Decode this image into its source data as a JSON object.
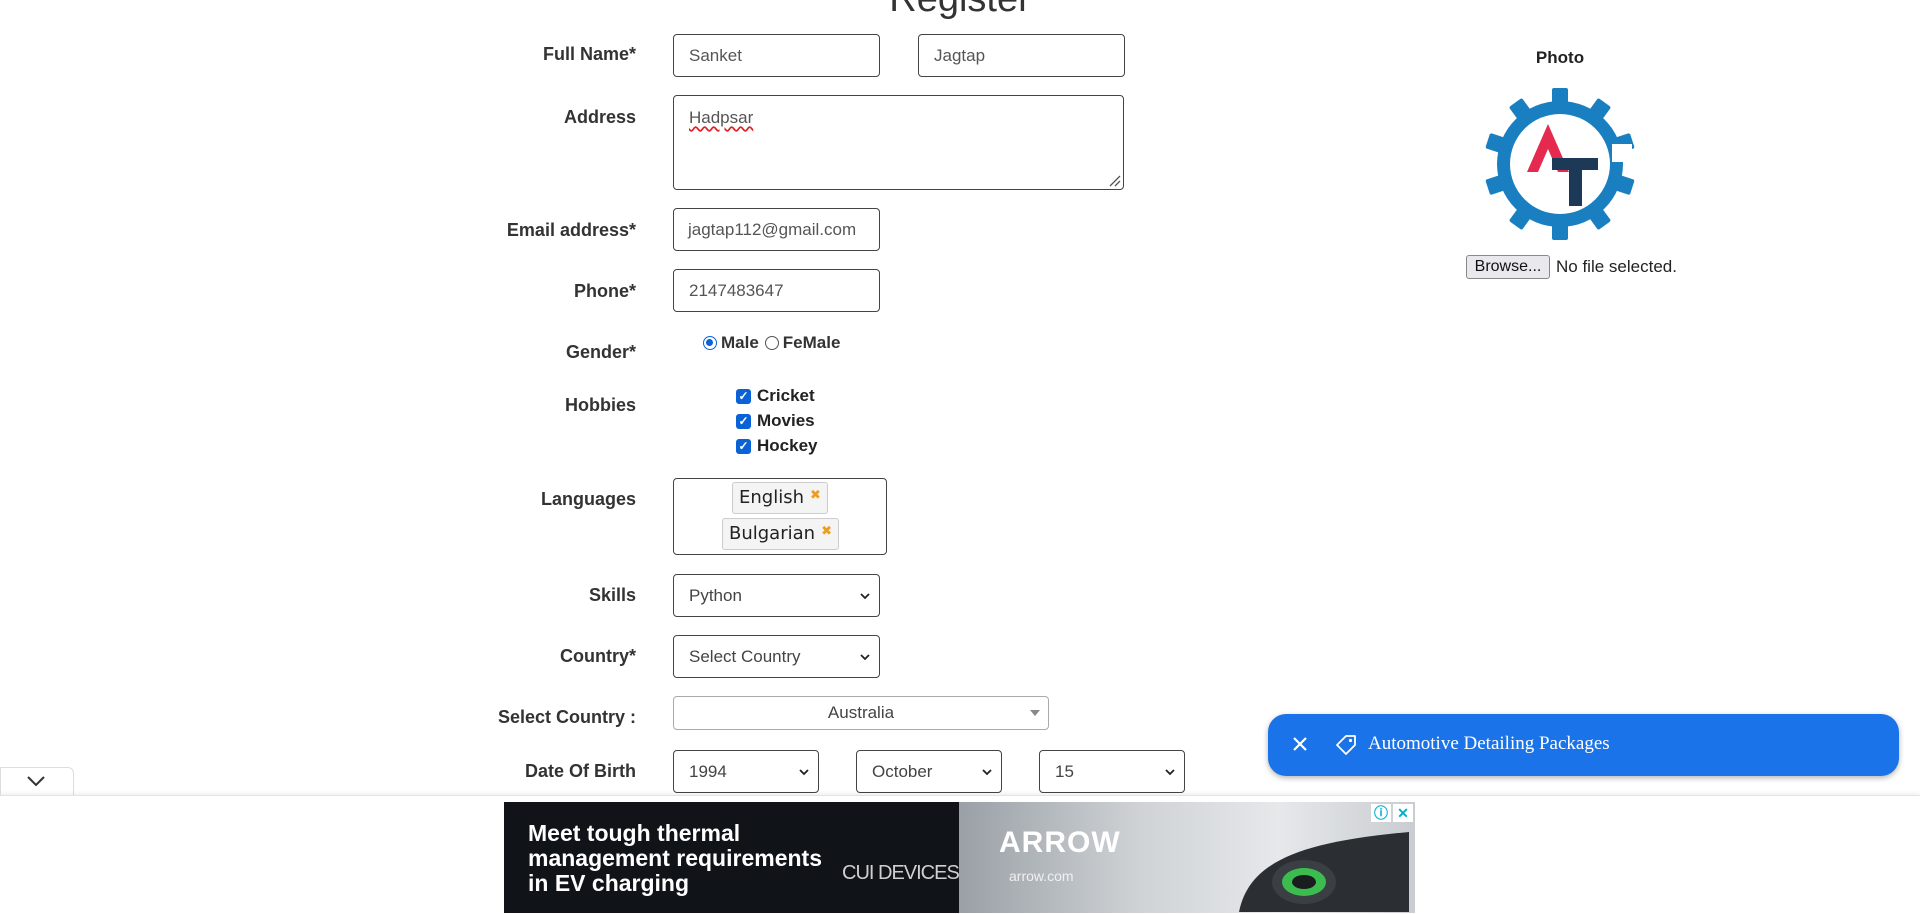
{
  "page": {
    "title": "Register"
  },
  "form": {
    "full_name": {
      "label": "Full Name*",
      "first": "Sanket",
      "last": "Jagtap"
    },
    "address": {
      "label": "Address",
      "value": "Hadpsar"
    },
    "email": {
      "label": "Email address*",
      "value": "jagtap112@gmail.com"
    },
    "phone": {
      "label": "Phone*",
      "value": "2147483647"
    },
    "gender": {
      "label": "Gender*",
      "options": [
        "Male",
        "FeMale"
      ],
      "selected": "Male"
    },
    "hobbies": {
      "label": "Hobbies",
      "items": [
        "Cricket",
        "Movies",
        "Hockey"
      ],
      "checked": [
        true,
        true,
        true
      ]
    },
    "languages": {
      "label": "Languages",
      "chips": [
        "English",
        "Bulgarian"
      ],
      "remove_glyph": "✖"
    },
    "skills": {
      "label": "Skills",
      "value": "Python"
    },
    "country": {
      "label": "Country*",
      "value": "Select Country"
    },
    "select_country": {
      "label": "Select Country :",
      "value": "Australia"
    },
    "dob": {
      "label": "Date Of Birth",
      "year": "1994",
      "month": "October",
      "day": "15"
    }
  },
  "photo": {
    "label": "Photo",
    "browse": "Browse...",
    "status": "No file selected.",
    "logo_icon": "gear-logo-icon",
    "logo_letters": "AT"
  },
  "popup": {
    "text": "Automotive Detailing Packages",
    "close_icon": "close-icon",
    "tag_icon": "tag-icon"
  },
  "ad": {
    "headline": "Meet tough thermal management requirements in EV charging",
    "brand_left": "CUI DEVICES",
    "brand_right": "ARROW",
    "url": "arrow.com",
    "info_glyph": "ⓘ",
    "close_glyph": "✕"
  },
  "colors": {
    "accent": "#0a63d6",
    "popup": "#1a73e8",
    "logo_blue": "#1a7fc1",
    "logo_red": "#e5294f",
    "logo_navy": "#1c3a57"
  }
}
